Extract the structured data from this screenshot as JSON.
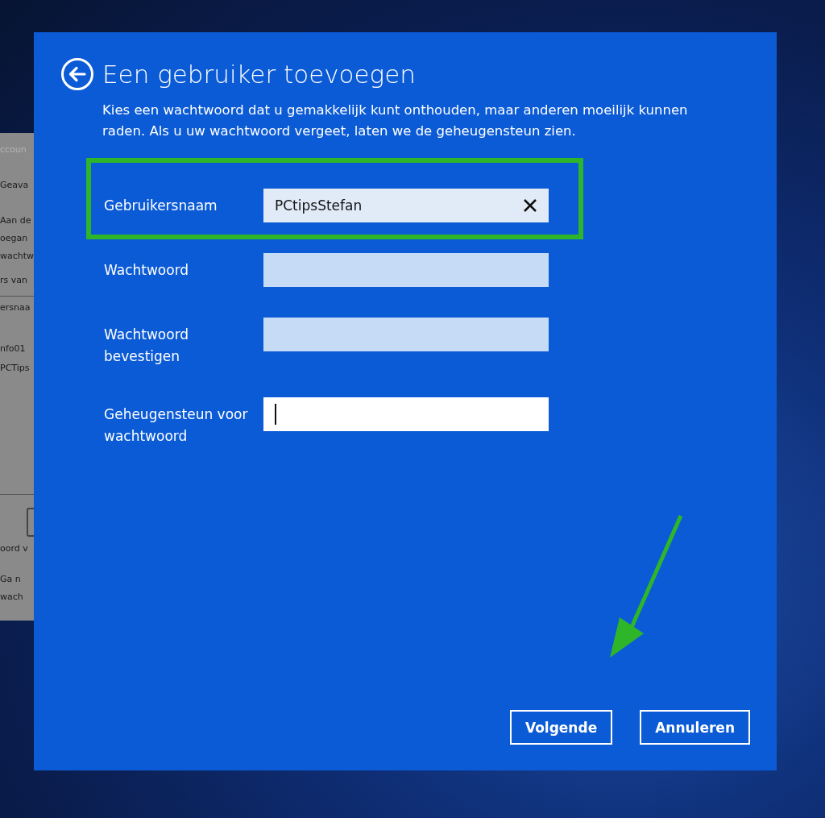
{
  "background_window": {
    "texts": [
      "ccoun",
      "Geava",
      "Aan de",
      "oegan",
      "wachtw",
      "rs van",
      "ersnaa",
      "nfo01",
      "PCTips",
      "oord v",
      "Ga n",
      "wach"
    ]
  },
  "dialog": {
    "title": "Een gebruiker toevoegen",
    "description": "Kies een wachtwoord dat u gemakkelijk kunt onthouden, maar anderen moeilijk kunnen raden. Als u uw wachtwoord vergeet, laten we de geheugensteun zien.",
    "fields": [
      {
        "label": "Gebruikersnaam",
        "value": "PCtipsStefan",
        "kind": "clearable",
        "highlighted": true
      },
      {
        "label": "Wachtwoord",
        "kind": "password",
        "highlighted": false
      },
      {
        "label": "Wachtwoord bevestigen",
        "kind": "password",
        "highlighted": false
      },
      {
        "label": "Geheugensteun voor wachtwoord",
        "kind": "focused",
        "highlighted": false
      }
    ],
    "buttons": [
      "Volgende",
      "Annuleren"
    ]
  }
}
